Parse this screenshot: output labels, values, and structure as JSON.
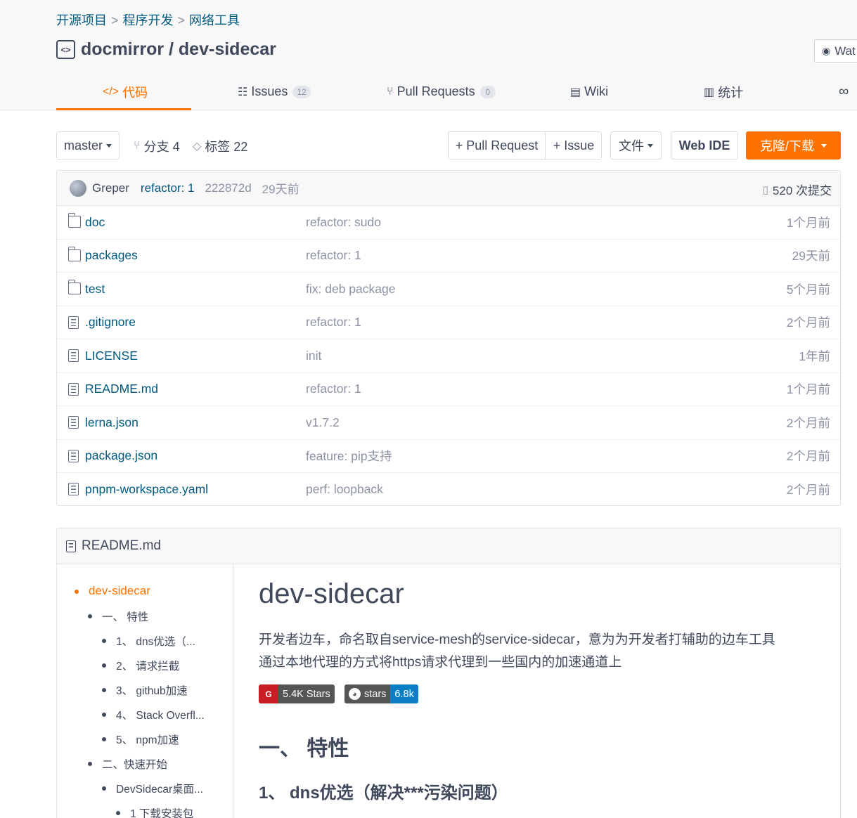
{
  "breadcrumb": [
    "开源项目",
    "程序开发",
    "网络工具"
  ],
  "repo": {
    "name": "docmirror / dev-sidecar",
    "watch_label": "Wat"
  },
  "tabs": [
    {
      "label": "代码",
      "icon": "code-icon"
    },
    {
      "label": "Issues",
      "count": "12",
      "icon": "issues-icon"
    },
    {
      "label": "Pull Requests",
      "count": "0",
      "icon": "pull-request-icon"
    },
    {
      "label": "Wiki",
      "icon": "wiki-icon"
    },
    {
      "label": "统计",
      "icon": "stats-icon"
    },
    {
      "label": "∞",
      "icon": "more-icon"
    }
  ],
  "toolbar": {
    "branch": "master",
    "branches": "分支 4",
    "tags": "标签 22",
    "pull_request": "+ Pull Request",
    "issue": "+ Issue",
    "file": "文件",
    "web_ide": "Web IDE",
    "clone": "克隆/下载"
  },
  "commit": {
    "author": "Greper",
    "message": "refactor: 1",
    "sha": "222872d",
    "time": "29天前",
    "count": "520 次提交"
  },
  "files": [
    {
      "name": "doc",
      "type": "folder",
      "commit": "refactor: sudo",
      "time": "1个月前"
    },
    {
      "name": "packages",
      "type": "folder",
      "commit": "refactor: 1",
      "time": "29天前"
    },
    {
      "name": "test",
      "type": "folder",
      "commit": "fix: deb package",
      "time": "5个月前"
    },
    {
      "name": ".gitignore",
      "type": "file",
      "commit": "refactor: 1",
      "time": "2个月前"
    },
    {
      "name": "LICENSE",
      "type": "file",
      "commit": "init",
      "time": "1年前"
    },
    {
      "name": "README.md",
      "type": "file",
      "commit": "refactor: 1",
      "time": "1个月前"
    },
    {
      "name": "lerna.json",
      "type": "file",
      "commit": "v1.7.2",
      "time": "2个月前"
    },
    {
      "name": "package.json",
      "type": "file",
      "commit": "feature: pip支持",
      "time": "2个月前"
    },
    {
      "name": "pnpm-workspace.yaml",
      "type": "file",
      "commit": "perf: loopback",
      "time": "2个月前"
    }
  ],
  "readme": {
    "header": "README.md",
    "toc": [
      {
        "label": "dev-sidecar",
        "level": 0
      },
      {
        "label": "一、 特性",
        "level": 1
      },
      {
        "label": "1、 dns优选（...",
        "level": 2
      },
      {
        "label": "2、 请求拦截",
        "level": 2
      },
      {
        "label": "3、 github加速",
        "level": 2
      },
      {
        "label": "4、 Stack Overfl...",
        "level": 2
      },
      {
        "label": "5、 npm加速",
        "level": 2
      },
      {
        "label": "二、快速开始",
        "level": 1
      },
      {
        "label": "DevSidecar桌面...",
        "level": 2
      },
      {
        "label": "1 下载安装包",
        "level": 3
      }
    ],
    "title": "dev-sidecar",
    "para1": "开发者边车，命名取自service-mesh的service-sidecar，意为为开发者打辅助的边车工具",
    "para2": "通过本地代理的方式将https请求代理到一些国内的加速通道上",
    "badge1": {
      "logo": "G",
      "text": "5.4K Stars",
      "color": "#555555"
    },
    "badge2": {
      "label": "stars",
      "value": "6.8k",
      "color": "#0b7ec4"
    },
    "h2": "一、 特性",
    "h3": "1、 dns优选（解决***污染问题）"
  },
  "colors": {
    "accent": "#fe7300",
    "link": "#005980",
    "muted": "#8c92a4"
  }
}
